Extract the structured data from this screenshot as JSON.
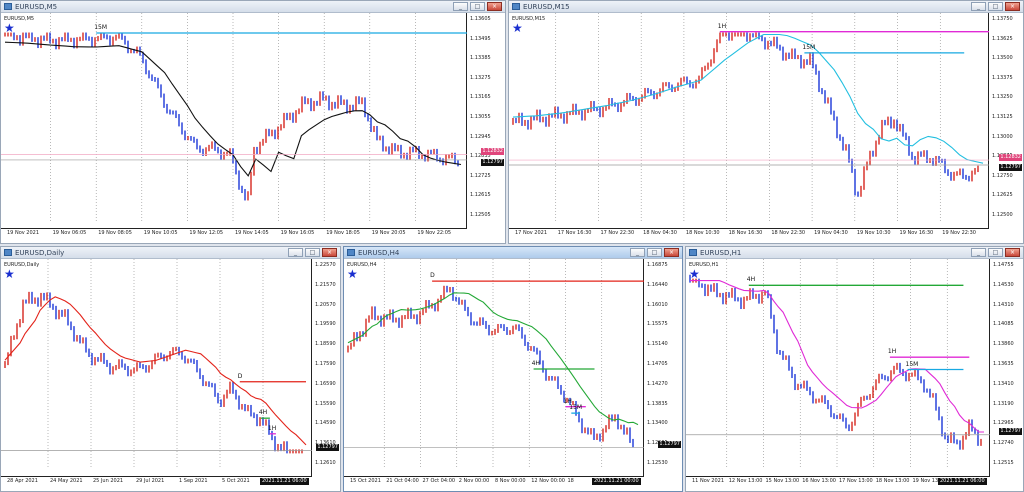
{
  "windows": [
    {
      "id": "m5",
      "title": "EURUSD,M5",
      "symbol_label": "EURUSD,M5",
      "price_labels": [
        "1.13605",
        "1.13495",
        "1.13385",
        "1.13275",
        "1.13165",
        "1.13055",
        "1.12945",
        "1.12835",
        "1.12725",
        "1.12615",
        "1.12505"
      ],
      "price_range": [
        1.1245,
        1.1366
      ],
      "time_labels": [
        "19 Nov 2021",
        "19 Nov 06:05",
        "19 Nov 08:05",
        "19 Nov 10:05",
        "19 Nov 12:05",
        "19 Nov 14:05",
        "19 Nov 16:05",
        "19 Nov 18:05",
        "19 Nov 20:05",
        "19 Nov 22:05"
      ],
      "tags": [
        {
          "text": "1.12832",
          "price": 1.12832,
          "color": "#e0457b"
        },
        {
          "text": "1.12797",
          "price": 1.12797,
          "color": "#111111"
        }
      ],
      "levels": [
        {
          "label": "15M",
          "price": 1.13597,
          "color": "#17a9e2",
          "from": 0.2
        }
      ],
      "ma_color": "#111111",
      "series_color_up": "#d5261e",
      "series_color_down": "#1b37d9",
      "active": false
    },
    {
      "id": "m15",
      "title": "EURUSD,M15",
      "symbol_label": "EURUSD,M15",
      "price_labels": [
        "1.13750",
        "1.13625",
        "1.13500",
        "1.13375",
        "1.13250",
        "1.13125",
        "1.13000",
        "1.12875",
        "1.12750",
        "1.12625",
        "1.12500"
      ],
      "price_range": [
        1.1244,
        1.1381
      ],
      "time_labels": [
        "17 Nov 2021",
        "17 Nov 16:30",
        "17 Nov 22:30",
        "18 Nov 04:30",
        "18 Nov 10:30",
        "18 Nov 16:30",
        "18 Nov 22:30",
        "19 Nov 04:30",
        "19 Nov 10:30",
        "19 Nov 16:30",
        "19 Nov 22:30"
      ],
      "tags": [
        {
          "text": "1.12832",
          "price": 1.12832,
          "color": "#e0457b"
        },
        {
          "text": "1.12797",
          "price": 1.12797,
          "color": "#111111"
        }
      ],
      "levels": [
        {
          "label": "1H",
          "price": 1.13748,
          "color": "#e02ad6",
          "from": 0.44
        },
        {
          "label": "15M",
          "price": 1.13597,
          "color": "#17a9e2",
          "from": 0.62,
          "to": 0.96
        }
      ],
      "ma_color": "#22bfe0",
      "series_color_up": "#d5261e",
      "series_color_down": "#1b37d9",
      "active": false
    },
    {
      "id": "d1",
      "title": "EURUSD,Daily",
      "symbol_label": "EURUSD,Daily",
      "price_labels": [
        "1.22570",
        "1.21570",
        "1.20570",
        "1.19590",
        "1.18590",
        "1.17590",
        "1.16590",
        "1.15590",
        "1.14590",
        "1.13610",
        "1.12610"
      ],
      "price_range": [
        1.121,
        1.2305
      ],
      "time_labels": [
        "28 Apr 2021",
        "24 May 2021",
        "25 Jun 2021",
        "29 Jul 2021",
        "1 Sep 2021",
        "5 Oct 2021",
        "2021.11.21 06:00"
      ],
      "tags": [
        {
          "text": "1.12797",
          "price": 1.12797,
          "color": "#111111"
        }
      ],
      "levels": [
        {
          "label": "D",
          "price": 1.16687,
          "color": "#e3231a",
          "from": 0.78,
          "to": 1.0
        },
        {
          "label": "4H",
          "price": 1.1463,
          "color": "#23a836",
          "from": 0.85,
          "to": 0.88
        },
        {
          "label": "1H",
          "price": 1.13748,
          "color": "#e02ad6",
          "from": 0.88,
          "to": 0.9
        }
      ],
      "ma_color": "#e3231a",
      "series_color_up": "#d5261e",
      "series_color_down": "#1b37d9",
      "active": false
    },
    {
      "id": "h4",
      "title": "EURUSD,H4",
      "symbol_label": "EURUSD,H4",
      "price_labels": [
        "1.16875",
        "1.16440",
        "1.16010",
        "1.15575",
        "1.15140",
        "1.14705",
        "1.14270",
        "1.13835",
        "1.13400",
        "1.12965",
        "1.12530"
      ],
      "price_range": [
        1.1243,
        1.1697
      ],
      "time_labels": [
        "15 Oct 2021",
        "21 Oct 04:00",
        "27 Oct 04:00",
        "2 Nov 00:00",
        "8 Nov 00:00",
        "12 Nov 00:00",
        "18",
        "2021.11.21 00:00"
      ],
      "tags": [
        {
          "text": "1.12797",
          "price": 1.12797,
          "color": "#111111"
        }
      ],
      "levels": [
        {
          "label": "D",
          "price": 1.16687,
          "color": "#e3231a",
          "from": 0.29
        },
        {
          "label": "4H",
          "price": 1.1463,
          "color": "#23a836",
          "from": 0.64,
          "to": 0.85
        },
        {
          "label": "1H",
          "price": 1.13748,
          "color": "#e02ad6",
          "from": 0.75,
          "to": 0.82
        },
        {
          "label": "15M",
          "price": 1.13597,
          "color": "#17a9e2",
          "from": 0.77,
          "to": 0.8
        }
      ],
      "ma_color": "#23a836",
      "series_color_up": "#d5261e",
      "series_color_down": "#1b37d9",
      "active": true
    },
    {
      "id": "h1",
      "title": "EURUSD,H1",
      "symbol_label": "EURUSD,H1",
      "price_labels": [
        "1.14755",
        "1.14530",
        "1.14310",
        "1.14085",
        "1.13860",
        "1.13635",
        "1.13410",
        "1.13190",
        "1.12965",
        "1.12740",
        "1.12515"
      ],
      "price_range": [
        1.1245,
        1.1483
      ],
      "time_labels": [
        "11 Nov 2021",
        "12 Nov 13:00",
        "15 Nov 13:00",
        "16 Nov 13:00",
        "17 Nov 13:00",
        "18 Nov 13:00",
        "19 Nov 13:00",
        "2021.11.21 06:00"
      ],
      "tags": [
        {
          "text": "1.12797",
          "price": 1.12797,
          "color": "#111111"
        }
      ],
      "levels": [
        {
          "label": "4H",
          "price": 1.1463,
          "color": "#23a836",
          "from": 0.2,
          "to": 0.93
        },
        {
          "label": "1H",
          "price": 1.13748,
          "color": "#e02ad6",
          "from": 0.68,
          "to": 0.95
        },
        {
          "label": "15M",
          "price": 1.13597,
          "color": "#17a9e2",
          "from": 0.74,
          "to": 0.93
        }
      ],
      "ma_color": "#e02ad6",
      "series_color_up": "#d5261e",
      "series_color_down": "#1b37d9",
      "active": false
    }
  ],
  "window_buttons": {
    "minimize": "_",
    "maximize": "□",
    "close": "×"
  },
  "icons": {
    "symbol": "chart-icon",
    "marker": "star-icon"
  },
  "star": "★"
}
